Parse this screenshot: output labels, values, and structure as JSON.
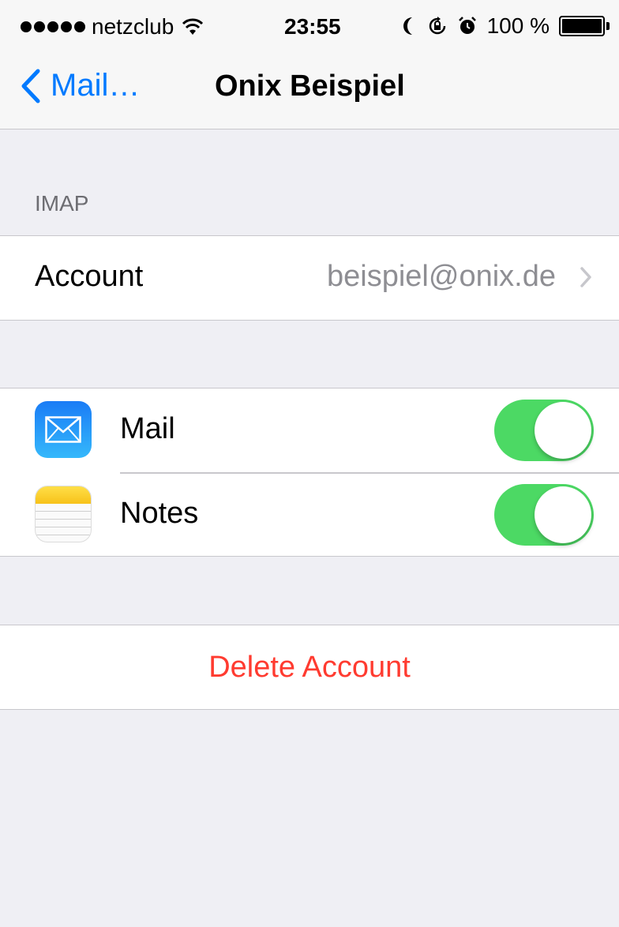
{
  "status_bar": {
    "carrier": "netzclub",
    "time": "23:55",
    "battery": "100 %",
    "icons": [
      "signal-dots-icon",
      "wifi-icon",
      "moon-icon",
      "orientation-lock-icon",
      "alarm-icon",
      "battery-icon"
    ]
  },
  "nav": {
    "back_label": "Mail…",
    "title": "Onix Beispiel"
  },
  "imap_section": {
    "header": "IMAP",
    "account_label": "Account",
    "account_value": "beispiel@onix.de"
  },
  "services": [
    {
      "label": "Mail",
      "icon": "mail-app-icon",
      "enabled": true
    },
    {
      "label": "Notes",
      "icon": "notes-app-icon",
      "enabled": true
    }
  ],
  "delete_label": "Delete Account",
  "colors": {
    "accent": "#007aff",
    "toggle_on": "#4cd964",
    "destructive": "#ff3b30",
    "background": "#efeff4"
  }
}
